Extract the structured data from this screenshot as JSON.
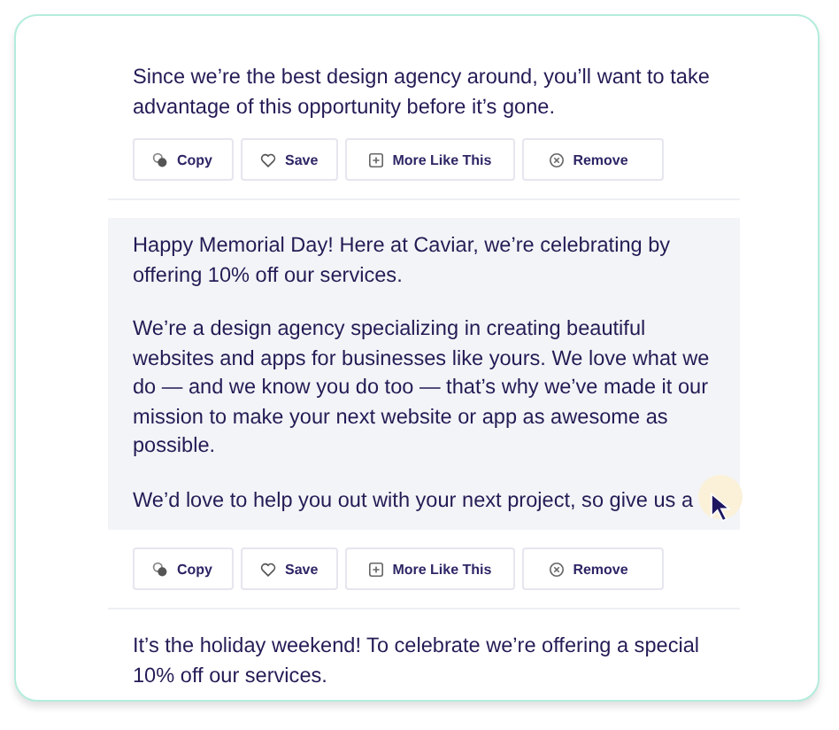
{
  "suggestions": [
    {
      "paragraphs": [
        "Since we’re the best design agency around, you’ll want to take advantage of this opportunity before it’s gone."
      ],
      "hovered": false,
      "actions": [
        {
          "kind": "copy",
          "label": "Copy"
        },
        {
          "kind": "save",
          "label": "Save"
        },
        {
          "kind": "more",
          "label": "More Like This"
        },
        {
          "kind": "remove",
          "label": "Remove"
        }
      ]
    },
    {
      "paragraphs": [
        "Happy Memorial Day! Here at Caviar, we’re celebrating by offering 10% off our services.",
        "We’re a design agency specializing in creating beautiful websites and apps for businesses like yours. We love what we do — and we know you do too — that’s why we’ve made it our mission to make your next website or app as awesome as possible.",
        "We’d love to help you out with your next project, so give us a"
      ],
      "hovered": true,
      "actions": [
        {
          "kind": "copy",
          "label": "Copy"
        },
        {
          "kind": "save",
          "label": "Save"
        },
        {
          "kind": "more",
          "label": "More Like This"
        },
        {
          "kind": "remove",
          "label": "Remove"
        }
      ]
    },
    {
      "paragraphs": [
        "It’s the holiday weekend! To celebrate we’re offering a special 10% off our services."
      ],
      "hovered": false
    }
  ]
}
